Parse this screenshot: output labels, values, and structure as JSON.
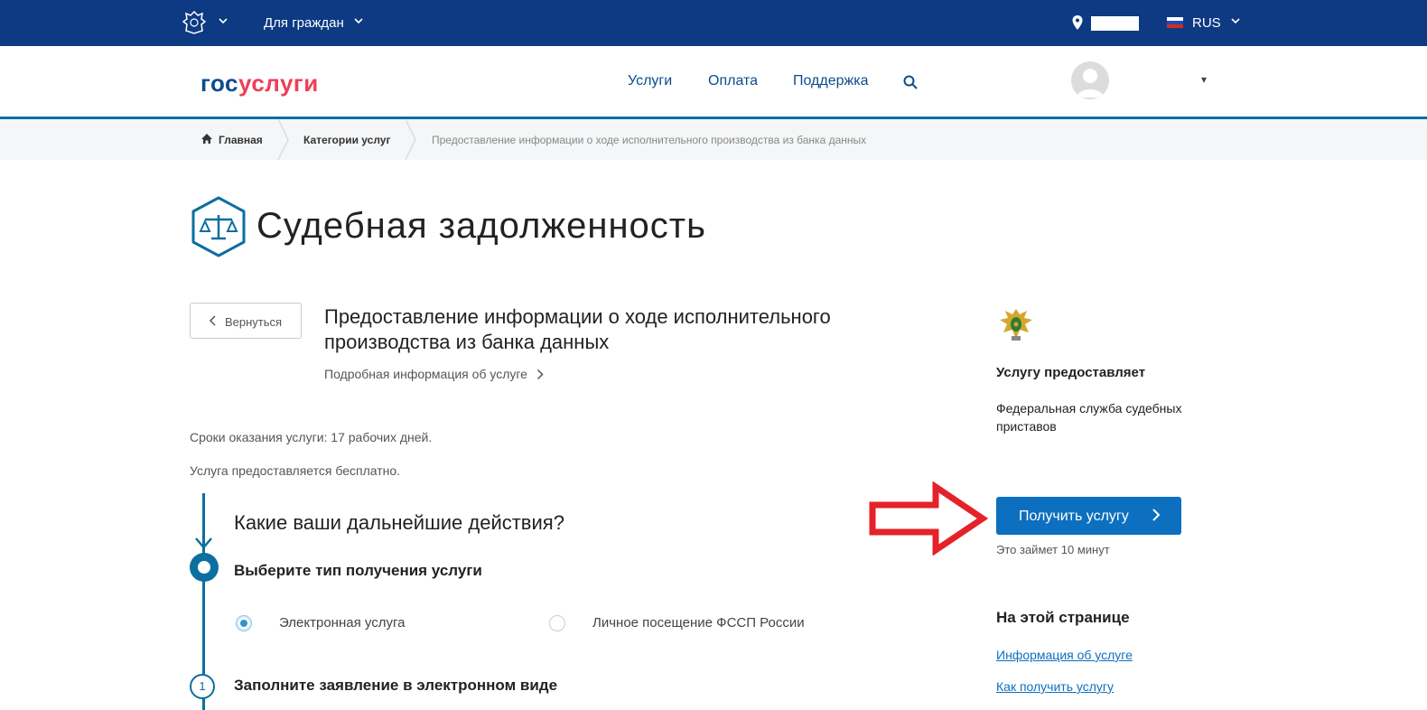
{
  "topbar": {
    "citizens_label": "Для граждан",
    "language": "RUS"
  },
  "header": {
    "logo_part1": "гос",
    "logo_part2": "услуги",
    "nav": [
      "Услуги",
      "Оплата",
      "Поддержка"
    ],
    "user_caret": "▾"
  },
  "breadcrumbs": [
    "Главная",
    "Категории услуг",
    "Предоставление информации о ходе исполнительного производства из банка данных"
  ],
  "page": {
    "title": "Судебная задолженность",
    "back_label": "Вернуться",
    "service_title": "Предоставление информации о ходе исполнительного производства из банка данных",
    "more_info": "Подробная информация об услуге",
    "terms": "Сроки оказания услуги: 17 рабочих дней.",
    "free": "Услуга предоставляется бесплатно."
  },
  "steps": {
    "question": "Какие ваши дальнейшие действия?",
    "step1_title": "Выберите тип получения услуги",
    "options": [
      {
        "label": "Электронная услуга",
        "selected": true
      },
      {
        "label": "Личное посещение ФССП России",
        "selected": false
      }
    ],
    "step2_number": "1",
    "step2_title": "Заполните заявление в электронном виде"
  },
  "sidebar": {
    "provider_heading": "Услугу предоставляет",
    "provider_name": "Федеральная служба судебных приставов",
    "get_service": "Получить услугу",
    "takes_time": "Это займет 10 минут",
    "on_page_heading": "На этой странице",
    "links": [
      "Информация об услуге",
      "Как получить услугу"
    ]
  },
  "colors": {
    "topbar": "#0d3a82",
    "accent": "#0d6f9f",
    "button": "#0d6fbf",
    "logo_red": "#ee3f58",
    "arrow": "#e52229"
  }
}
